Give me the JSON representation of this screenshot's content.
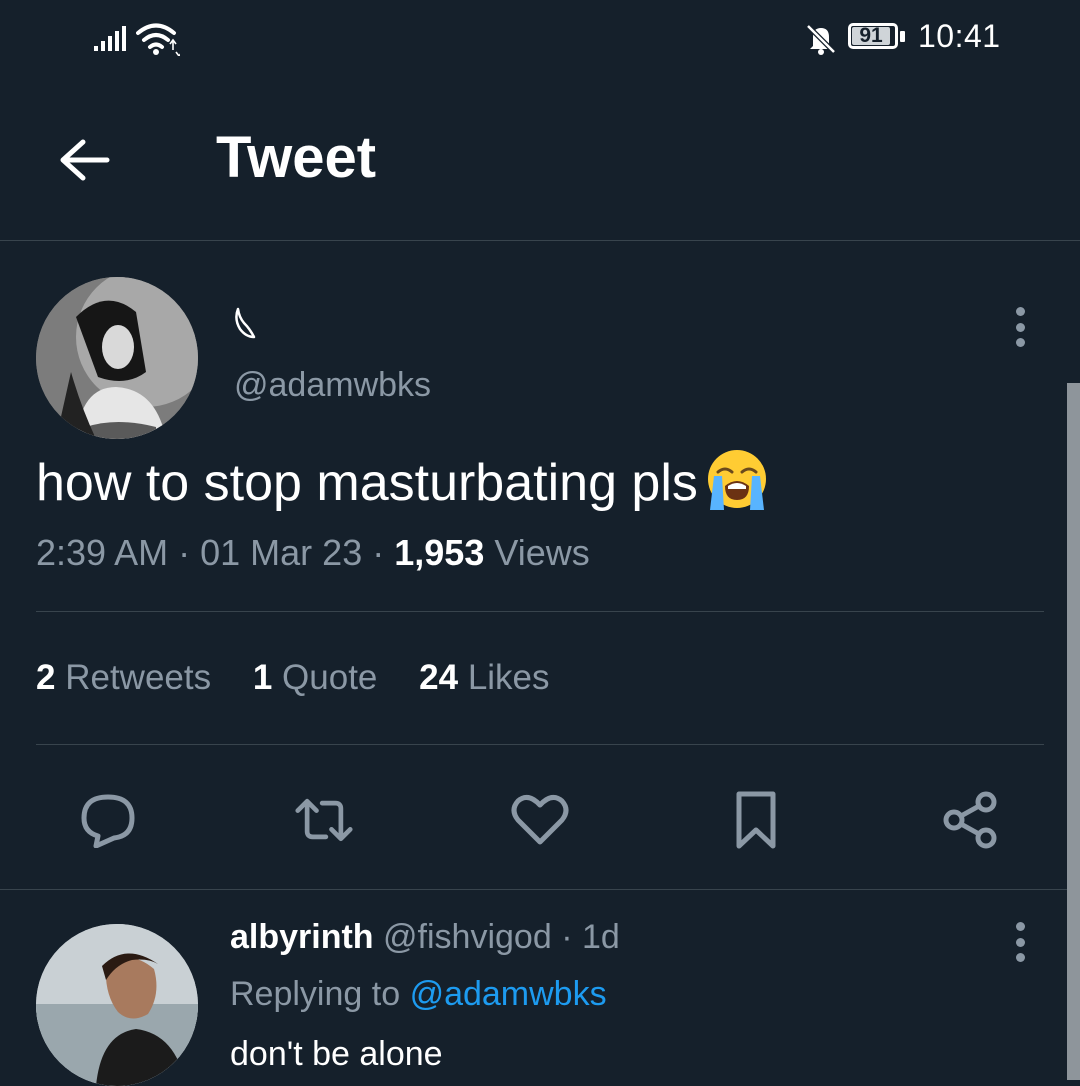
{
  "status_bar": {
    "time": "10:41",
    "battery": "91",
    "icons": [
      "signal-icon",
      "wifi-icon",
      "notifications-off-icon",
      "battery-icon"
    ]
  },
  "header": {
    "title": "Tweet",
    "back_icon": "arrow-left-icon"
  },
  "tweet": {
    "handle": "@adamwbks",
    "text": "how to stop masturbating pls",
    "emoji": "loudly-crying-face-emoji",
    "time": "2:39 AM",
    "date": "01 Mar 23",
    "views_count": "1,953",
    "views_label": "Views",
    "separator": "·",
    "stats": {
      "retweets_count": "2",
      "retweets_label": "Retweets",
      "quotes_count": "1",
      "quotes_label": "Quote",
      "likes_count": "24",
      "likes_label": "Likes"
    },
    "actions": [
      "reply-icon",
      "retweet-icon",
      "like-icon",
      "bookmark-icon",
      "share-icon"
    ]
  },
  "reply": {
    "name": "albyrinth",
    "handle": "@fishvigod",
    "separator": "·",
    "age": "1d",
    "replying_prefix": "Replying to",
    "replying_handle": "@adamwbks",
    "text": "don't be alone"
  },
  "colors": {
    "background": "#15202b",
    "secondary_text": "#8b98a5",
    "link": "#1d9bf0",
    "divider": "#38444d"
  }
}
